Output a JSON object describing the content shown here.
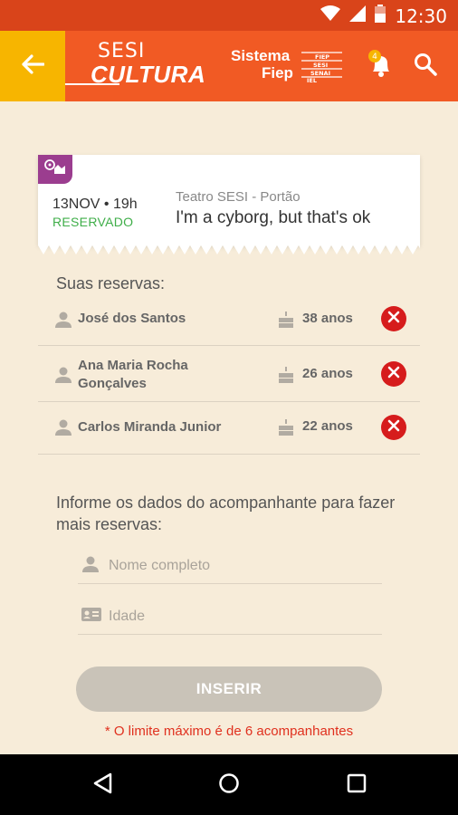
{
  "status_bar": {
    "time": "12:30"
  },
  "header": {
    "logo_top": "SESI",
    "logo_bottom": "CULTURA",
    "partner_line1": "Sistema",
    "partner_line2": "Fiep",
    "partner_box_lines": [
      "FIEP",
      "SESI",
      "SENAI",
      "IEL"
    ],
    "notification_count": "4"
  },
  "event": {
    "date": "13NOV • 19h",
    "status": "RESERVADO",
    "venue": "Teatro SESI - Portão",
    "title": "I'm a cyborg, but that's ok"
  },
  "reservations": {
    "label": "Suas reservas:",
    "items": [
      {
        "name_line1": "José dos Santos",
        "name_line2": "",
        "age": "38 anos"
      },
      {
        "name_line1": "Ana Maria Rocha",
        "name_line2": "Gonçalves",
        "age": "26 anos"
      },
      {
        "name_line1": "Carlos Miranda Junior",
        "name_line2": "",
        "age": "22 anos"
      }
    ]
  },
  "companion": {
    "info": "Informe os dados do acompanhante para fazer mais reservas:",
    "name_placeholder": "Nome completo",
    "age_placeholder": "Idade",
    "insert_label": "INSERIR",
    "limit_note": "* O limite máximo é de 6 acompanhantes"
  },
  "colors": {
    "brand_orange": "#f15a24",
    "back_yellow": "#f7b500",
    "status_green": "#3fae49",
    "remove_red": "#d61c1c",
    "category_purple": "#9b3d8f"
  }
}
